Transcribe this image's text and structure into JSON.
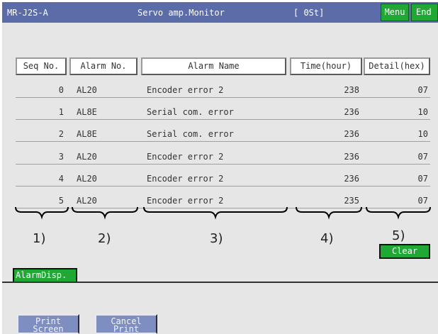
{
  "titlebar": {
    "model": "MR-J2S-A",
    "title": "Servo amp.Monitor",
    "status": "[ 0St]",
    "menu_label": "Menu",
    "end_label": "End"
  },
  "table": {
    "headers": [
      "Seq No.",
      "Alarm No.",
      "Alarm Name",
      "Time(hour)",
      "Detail(hex)"
    ],
    "rows": [
      {
        "seq": "0",
        "alarm_no": "AL20",
        "alarm_name": "Encoder error 2",
        "time": "238",
        "detail": "07"
      },
      {
        "seq": "1",
        "alarm_no": "AL8E",
        "alarm_name": "Serial com. error",
        "time": "236",
        "detail": "10"
      },
      {
        "seq": "2",
        "alarm_no": "AL8E",
        "alarm_name": "Serial com. error",
        "time": "236",
        "detail": "10"
      },
      {
        "seq": "3",
        "alarm_no": "AL20",
        "alarm_name": "Encoder error 2",
        "time": "236",
        "detail": "07"
      },
      {
        "seq": "4",
        "alarm_no": "AL20",
        "alarm_name": "Encoder error 2",
        "time": "236",
        "detail": "07"
      },
      {
        "seq": "5",
        "alarm_no": "AL20",
        "alarm_name": "Encoder error 2",
        "time": "235",
        "detail": "07"
      }
    ]
  },
  "callouts": [
    "1)",
    "2)",
    "3)",
    "4)",
    "5)"
  ],
  "clear_label": "Clear",
  "alarm_tab_label": "AlarmDisp.",
  "bottom_buttons": {
    "print_screen": "Print\nScreen",
    "cancel_print": "Cancel\nPrint"
  },
  "colors": {
    "titlebar": "#5b6ca8",
    "button_green": "#1fa834",
    "panel": "#e6e6e6",
    "bottom_button": "#7e8ec0"
  }
}
